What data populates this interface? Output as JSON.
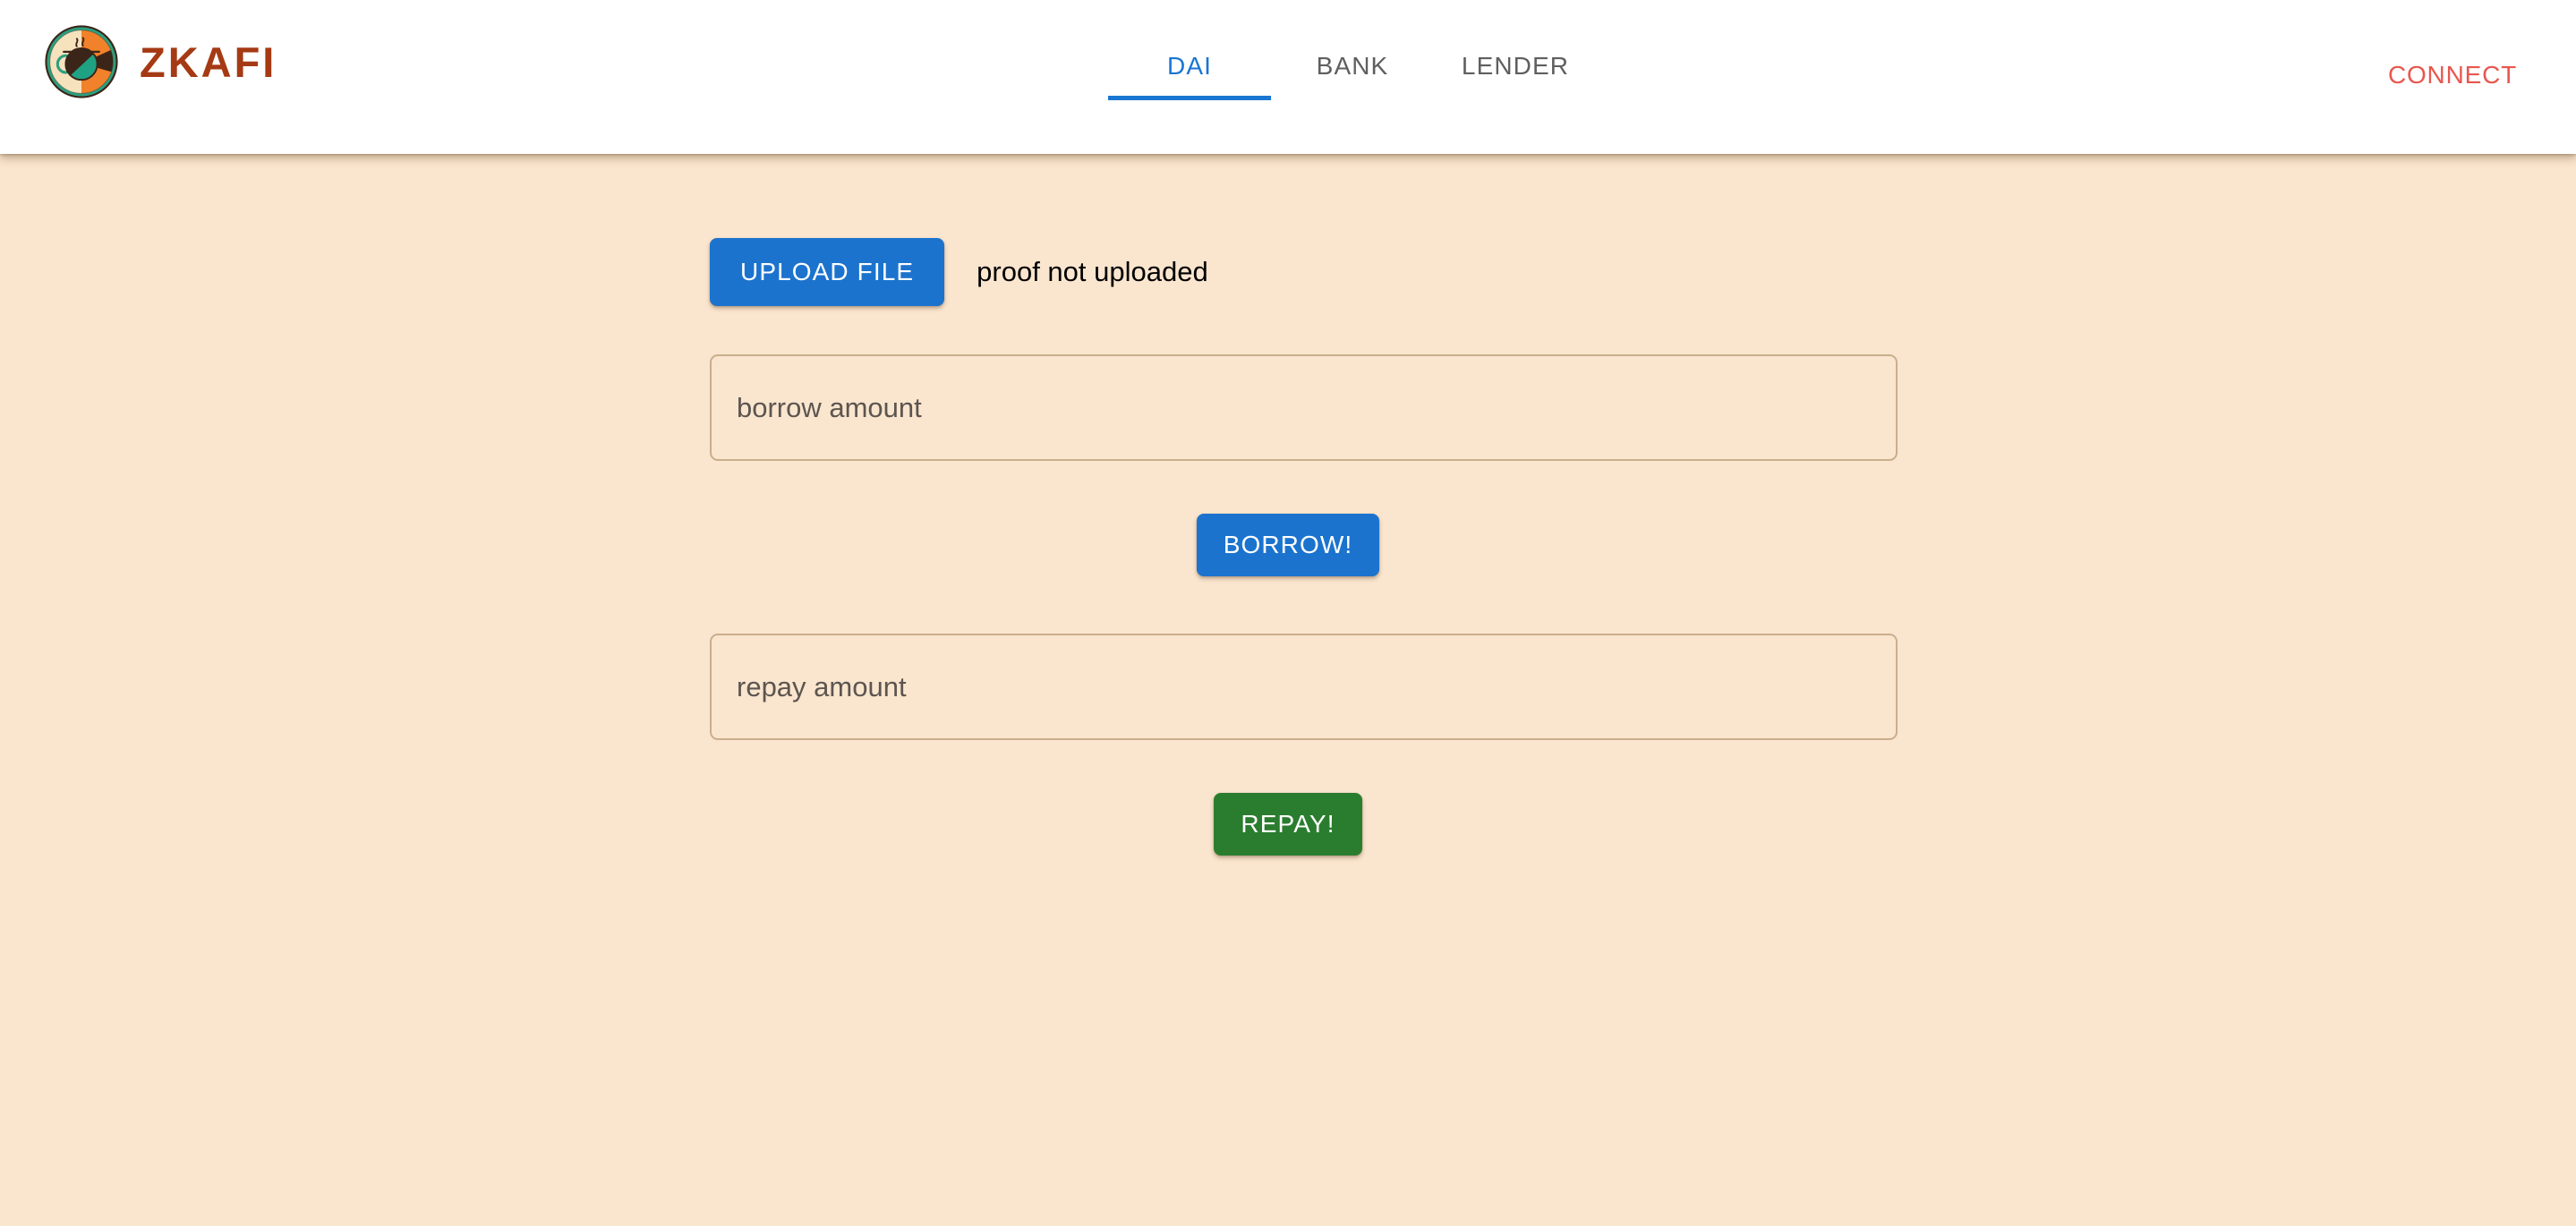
{
  "header": {
    "brand_name": "ZKAFI",
    "logo_icon": "coffee-cup-circle-logo",
    "nav_items": [
      {
        "label": "DAI",
        "active": true
      },
      {
        "label": "BANK",
        "active": false
      },
      {
        "label": "LENDER",
        "active": false
      }
    ],
    "connect_label": "CONNECT",
    "colors": {
      "brand_text": "#A53A14",
      "active_tab": "#1976D2",
      "inactive_tab": "#5F5F5F",
      "connect": "#E8574F",
      "bar_background": "#FFFFFF"
    }
  },
  "main": {
    "background_color": "#FAE5CE",
    "upload": {
      "button_label": "UPLOAD FILE",
      "button_color": "#1B73CE",
      "status_text": "proof not uploaded"
    },
    "borrow": {
      "input_value": "",
      "input_placeholder": "borrow amount",
      "button_label": "BORROW!",
      "button_color": "#1B73CE"
    },
    "repay": {
      "input_value": "",
      "input_placeholder": "repay amount",
      "button_label": "REPAY!",
      "button_color": "#2A7D2E"
    }
  }
}
